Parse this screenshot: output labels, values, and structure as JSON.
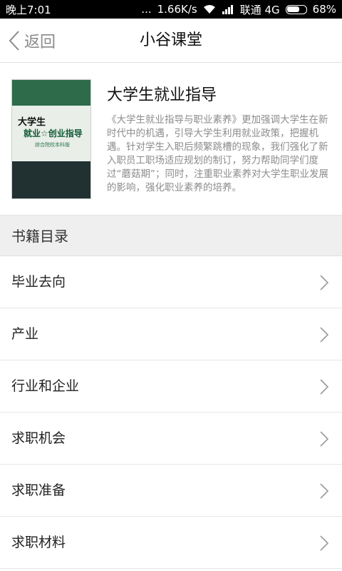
{
  "status_bar": {
    "time": "晚上7:01",
    "signal_dots": "...",
    "speed": "1.66K/s",
    "carrier": "联通 4G",
    "battery": "68%",
    "battery_level": 0.68
  },
  "nav": {
    "back_label": "返回",
    "title": "小谷课堂"
  },
  "book": {
    "title": "大学生就业指导",
    "description": "《大学生就业指导与职业素养》更加强调大学生在新时代中的机遇，引导大学生利用就业政策，把握机遇。针对学生入职后频繁跳槽的现象，我们强化了新入职员工职场适应规划的制订，努力帮助同学们度过“蘑菇期”；同时，注重职业素养对大学生职业发展的影响，强化职业素养的培养。",
    "cover": {
      "title_line1": "大学生",
      "title_line2": "就业☆创业指导",
      "subtitle": "综合院校本科版"
    }
  },
  "toc": {
    "header": "书籍目录",
    "items": [
      {
        "label": "毕业去向"
      },
      {
        "label": "产业"
      },
      {
        "label": "行业和企业"
      },
      {
        "label": "求职机会"
      },
      {
        "label": "求职准备"
      },
      {
        "label": "求职材料"
      }
    ]
  },
  "colors": {
    "accent_green": "#2d6b4b",
    "section_bg": "#efefef",
    "muted_text": "#8c8c8c"
  }
}
